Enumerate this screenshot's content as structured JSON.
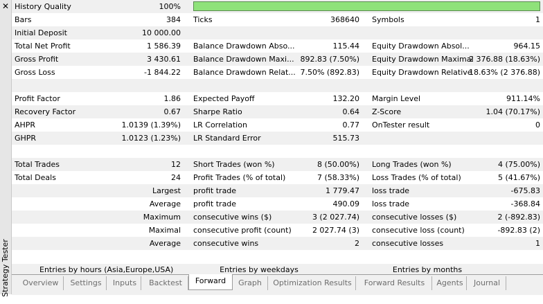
{
  "panel": {
    "title": "Strategy Tester",
    "close_glyph": "✕"
  },
  "summary_rows": [
    [
      "History Quality",
      "100%",
      "",
      "",
      "",
      ""
    ],
    [
      "Bars",
      "384",
      "Ticks",
      "368640",
      "Symbols",
      "1"
    ],
    [
      "Initial Deposit",
      "10 000.00",
      "",
      "",
      "",
      ""
    ],
    [
      "Total Net Profit",
      "1 586.39",
      "Balance Drawdown Abso...",
      "115.44",
      "Equity Drawdown Absol...",
      "964.15"
    ],
    [
      "Gross Profit",
      "3 430.61",
      "Balance Drawdown Maxi...",
      "892.83 (7.50%)",
      "Equity Drawdown Maximal",
      "2 376.88 (18.63%)"
    ],
    [
      "Gross Loss",
      "-1 844.22",
      "Balance Drawdown Relat...",
      "7.50% (892.83)",
      "Equity Drawdown Relative",
      "18.63% (2 376.88)"
    ],
    [
      "",
      "",
      "",
      "",
      "",
      ""
    ],
    [
      "Profit Factor",
      "1.86",
      "Expected Payoff",
      "132.20",
      "Margin Level",
      "911.14%"
    ],
    [
      "Recovery Factor",
      "0.67",
      "Sharpe Ratio",
      "0.64",
      "Z-Score",
      "1.04 (70.17%)"
    ],
    [
      "AHPR",
      "1.0139 (1.39%)",
      "LR Correlation",
      "0.77",
      "OnTester result",
      "0"
    ],
    [
      "GHPR",
      "1.0123 (1.23%)",
      "LR Standard Error",
      "515.73",
      "",
      ""
    ],
    [
      "",
      "",
      "",
      "",
      "",
      ""
    ],
    [
      "Total Trades",
      "12",
      "Short Trades (won %)",
      "8 (50.00%)",
      "Long Trades (won %)",
      "4 (75.00%)"
    ],
    [
      "Total Deals",
      "24",
      "Profit Trades (% of total)",
      "7 (58.33%)",
      "Loss Trades (% of total)",
      "5 (41.67%)"
    ]
  ],
  "trade_rows": [
    [
      "Largest",
      "profit trade",
      "1 779.47",
      "loss trade",
      "-675.83"
    ],
    [
      "Average",
      "profit trade",
      "490.09",
      "loss trade",
      "-368.84"
    ],
    [
      "Maximum",
      "consecutive wins ($)",
      "3 (2 027.74)",
      "consecutive losses ($)",
      "2 (-892.83)"
    ],
    [
      "Maximal",
      "consecutive profit (count)",
      "2 027.74 (3)",
      "consecutive loss (count)",
      "-892.83 (2)"
    ],
    [
      "Average",
      "consecutive wins",
      "2",
      "consecutive losses",
      "1"
    ]
  ],
  "sub_tabs": [
    "Entries by hours (Asia,Europe,USA)",
    "Entries by weekdays",
    "Entries by months"
  ],
  "tabs": [
    "Overview",
    "Settings",
    "Inputs",
    "Backtest",
    "Forward",
    "Graph",
    "Optimization Results",
    "Forward Results",
    "Agents",
    "Journal"
  ],
  "active_tab": "Forward",
  "colors": {
    "quality_bar": "#8fe27a",
    "alt_row": "#f0f0f0"
  }
}
